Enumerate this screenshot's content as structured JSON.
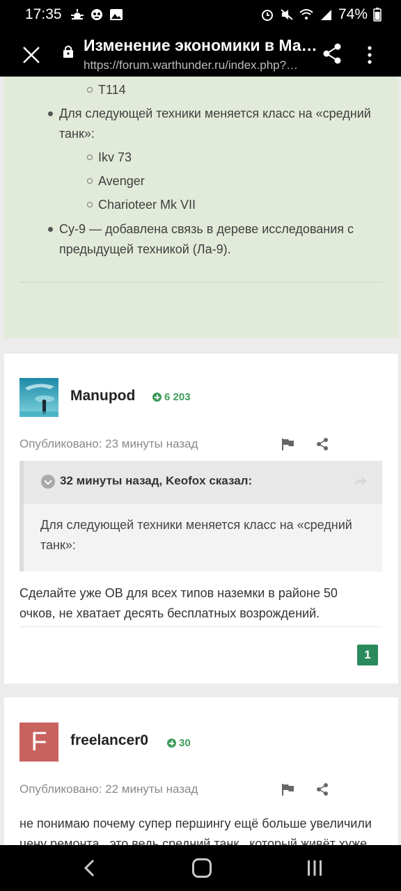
{
  "status_bar": {
    "time": "17:35",
    "battery": "74%",
    "left_icons": [
      "weather-icon",
      "notification-icon",
      "gallery-icon"
    ],
    "right_icons": [
      "alarm-icon",
      "mute-icon",
      "wifi-icon",
      "signal-icon",
      "battery-icon"
    ]
  },
  "toolbar": {
    "title": "Изменение экономики в Мае…",
    "url": "https://forum.warthunder.ru/index.php?…"
  },
  "green_card": {
    "items": [
      {
        "level": 2,
        "text": "T114"
      },
      {
        "level": 1,
        "text": "Для следующей техники меняется класс на «средний танк»:"
      },
      {
        "level": 2,
        "text": "Ikv 73"
      },
      {
        "level": 2,
        "text": "Avenger"
      },
      {
        "level": 2,
        "text": "Charioteer Mk VII"
      },
      {
        "level": 1,
        "text": "Су-9 — добавлена связь в дереве исследования с предыдущей техникой (Ла-9)."
      }
    ]
  },
  "posts": [
    {
      "username": "Manupod",
      "reputation": "6 203",
      "published": "Опубликовано: 23 минуты назад",
      "quote": {
        "author": "32 минуты назад, Keofox сказал:",
        "text": "Для следующей техники меняется класс на «средний танк»:"
      },
      "text": "Сделайте уже ОВ для всех типов наземки в районе 50 очков, не хватает десять бесплатных возрождений.",
      "reaction_count": "1"
    },
    {
      "username": "freelancer0",
      "avatar_letter": "F",
      "reputation": "30",
      "published": "Опубликовано: 22 минуты назад",
      "text": "не понимаю почему супер першингу ещё больше увеличили цену ремонта , это ведь средний танк , который живёт хуже"
    }
  ],
  "colors": {
    "accent_green": "#2b8a5c",
    "reputation_green": "#3e9b5a",
    "quoted_card_bg": "#e2ebda",
    "avatar_f_bg": "#c8625e"
  }
}
